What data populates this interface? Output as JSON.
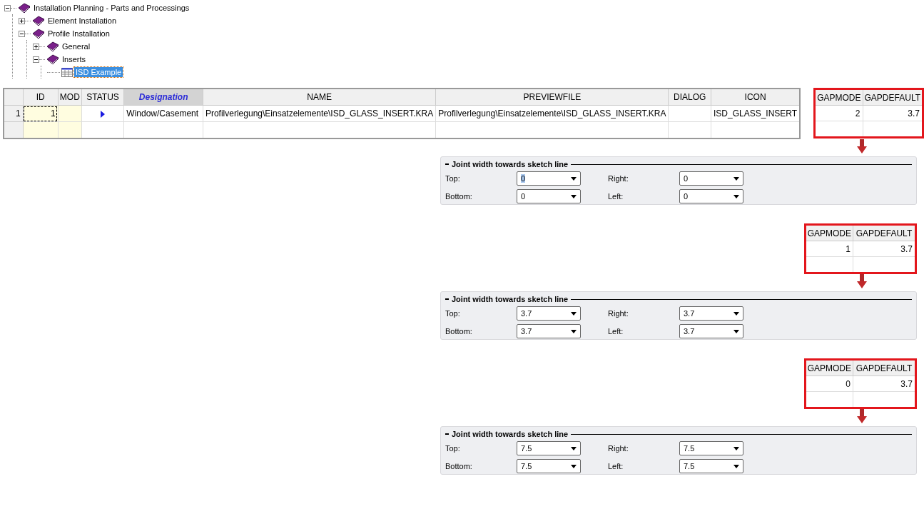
{
  "tree": [
    {
      "label": "Installation Planning - Parts and Processings",
      "expanded": true,
      "selected": false,
      "children": [
        {
          "label": "Element Installation",
          "expanded": false,
          "selected": false
        },
        {
          "label": "Profile Installation",
          "expanded": true,
          "selected": false,
          "children": [
            {
              "label": "General",
              "expanded": false,
              "selected": false
            },
            {
              "label": "Inserts",
              "expanded": true,
              "selected": false,
              "children": [
                {
                  "label": "ISD Example",
                  "selected": true
                }
              ]
            }
          ]
        }
      ]
    }
  ],
  "main_table": {
    "columns": [
      {
        "label": "ID",
        "selected": false
      },
      {
        "label": "MOD",
        "selected": false
      },
      {
        "label": "STATUS",
        "selected": false
      },
      {
        "label": "Designation",
        "selected": true
      },
      {
        "label": "NAME",
        "selected": false
      },
      {
        "label": "PREVIEWFILE",
        "selected": false
      },
      {
        "label": "DIALOG",
        "selected": false
      },
      {
        "label": "ICON",
        "selected": false
      }
    ],
    "rows": [
      {
        "header": "1",
        "current": true,
        "cells": [
          "1",
          "",
          "",
          "Window/Casement",
          "Profilverlegung\\Einsatzelemente\\ISD_GLASS_INSERT.KRA",
          "Profilverlegung\\Einsatzelemente\\ISD_GLASS_INSERT.KRA",
          "",
          "ISD_GLASS_INSERT"
        ]
      }
    ]
  },
  "examples": [
    {
      "gap_table": {
        "columns": [
          "GAPMODE",
          "GAPDEFAULT"
        ],
        "values": [
          "2",
          "3.7"
        ]
      },
      "panel": {
        "title": "Joint width towards sketch line",
        "fields": [
          {
            "label": "Top:",
            "value": "0",
            "highlighted": true
          },
          {
            "label": "Right:",
            "value": "0",
            "highlighted": false
          },
          {
            "label": "Bottom:",
            "value": "0",
            "highlighted": false
          },
          {
            "label": "Left:",
            "value": "0",
            "highlighted": false
          }
        ]
      }
    },
    {
      "gap_table": {
        "columns": [
          "GAPMODE",
          "GAPDEFAULT"
        ],
        "values": [
          "1",
          "3.7"
        ]
      },
      "panel": {
        "title": "Joint width towards sketch line",
        "fields": [
          {
            "label": "Top:",
            "value": "3.7",
            "highlighted": false
          },
          {
            "label": "Right:",
            "value": "3.7",
            "highlighted": false
          },
          {
            "label": "Bottom:",
            "value": "3.7",
            "highlighted": false
          },
          {
            "label": "Left:",
            "value": "3.7",
            "highlighted": false
          }
        ]
      }
    },
    {
      "gap_table": {
        "columns": [
          "GAPMODE",
          "GAPDEFAULT"
        ],
        "values": [
          "0",
          "3.7"
        ]
      },
      "panel": {
        "title": "Joint width towards sketch line",
        "fields": [
          {
            "label": "Top:",
            "value": "7.5",
            "highlighted": false
          },
          {
            "label": "Right:",
            "value": "7.5",
            "highlighted": false
          },
          {
            "label": "Bottom:",
            "value": "7.5",
            "highlighted": false
          },
          {
            "label": "Left:",
            "value": "7.5",
            "highlighted": false
          }
        ]
      }
    }
  ]
}
